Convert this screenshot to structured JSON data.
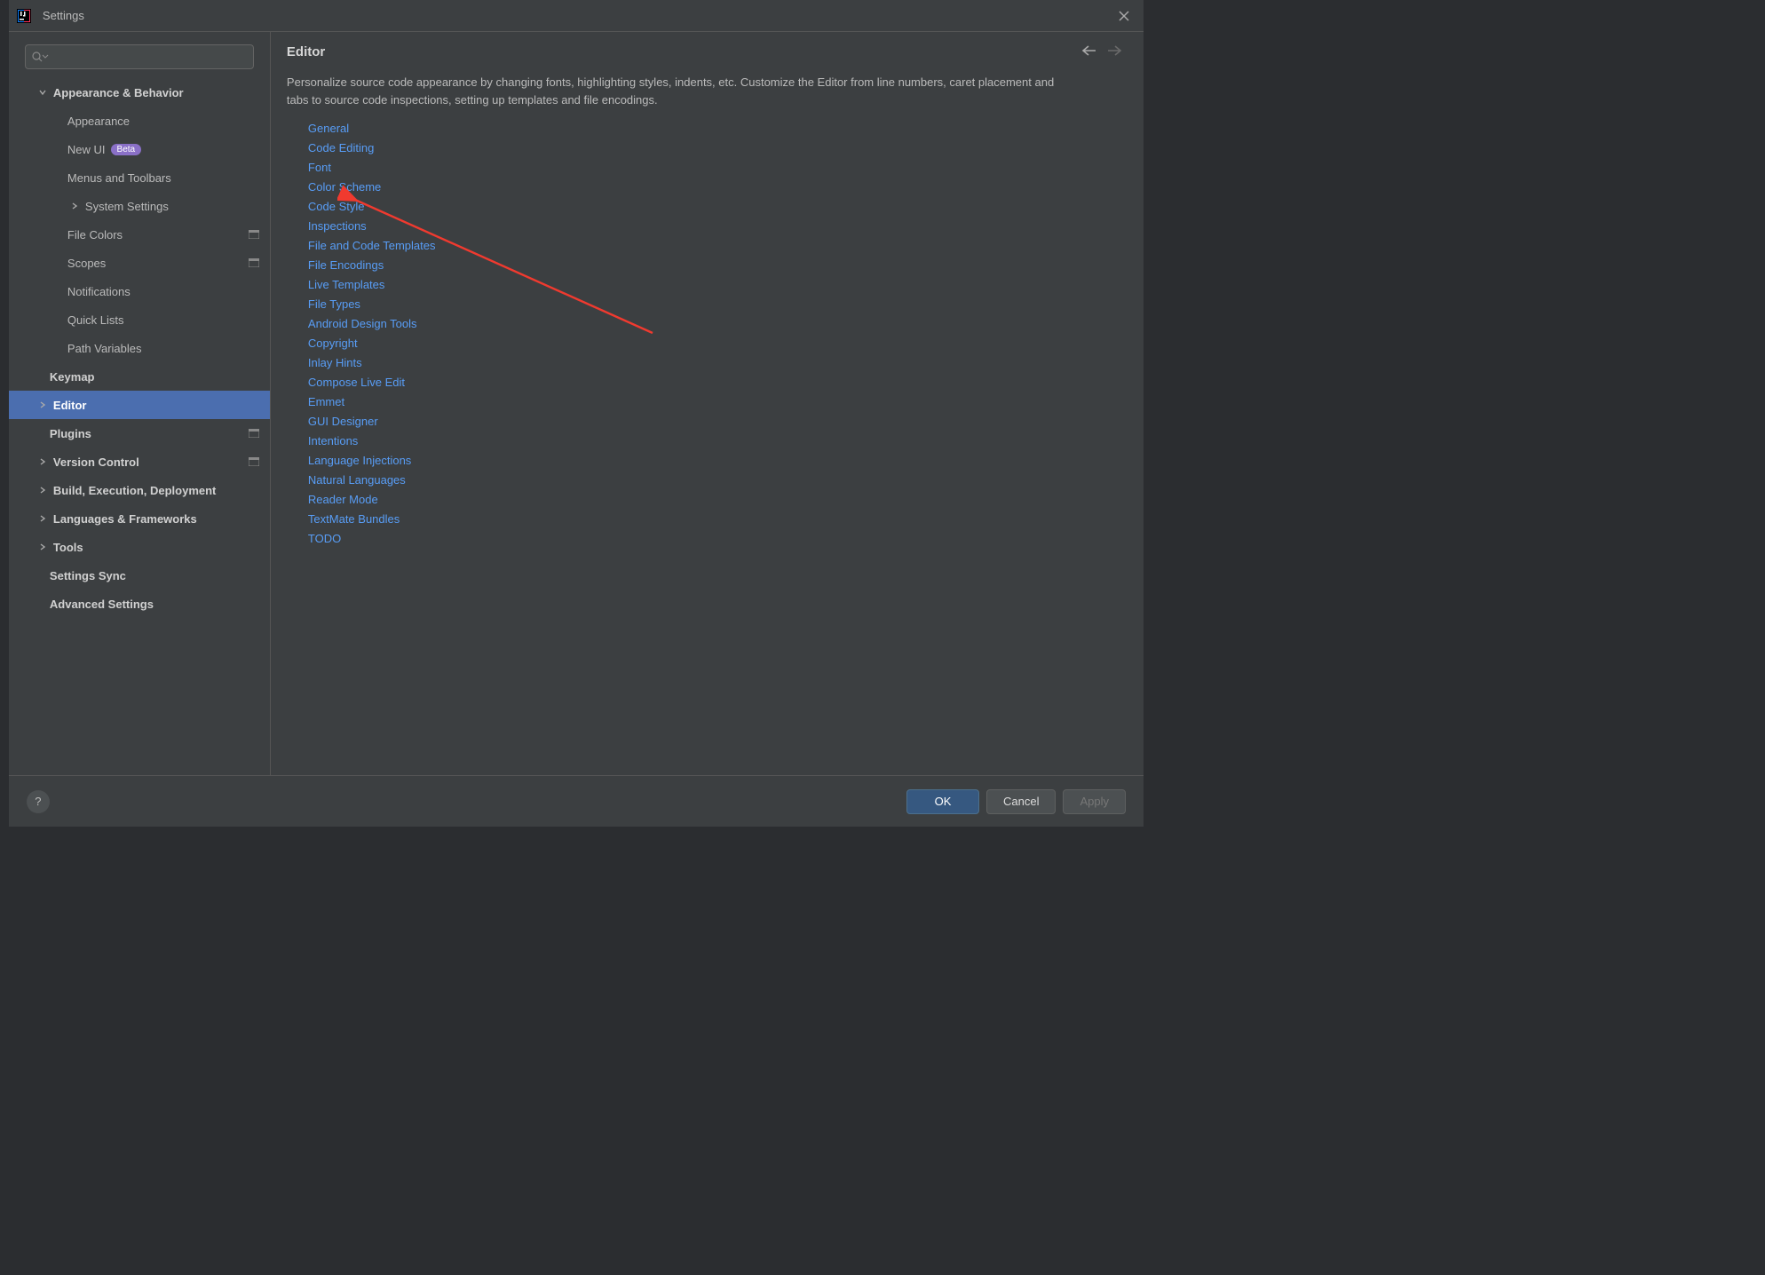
{
  "window": {
    "title": "Settings"
  },
  "sidebar": {
    "items": [
      {
        "label": "Appearance & Behavior",
        "depth": 1,
        "bold": true,
        "chev": "down"
      },
      {
        "label": "Appearance",
        "depth": 2
      },
      {
        "label": "New UI",
        "depth": 2,
        "badge": "Beta"
      },
      {
        "label": "Menus and Toolbars",
        "depth": 2
      },
      {
        "label": "System Settings",
        "depth": 2,
        "chev": "right"
      },
      {
        "label": "File Colors",
        "depth": 2,
        "projIcon": true
      },
      {
        "label": "Scopes",
        "depth": 2,
        "projIcon": true
      },
      {
        "label": "Notifications",
        "depth": 2
      },
      {
        "label": "Quick Lists",
        "depth": 2
      },
      {
        "label": "Path Variables",
        "depth": 2
      },
      {
        "label": "Keymap",
        "depth": 1,
        "bold": true
      },
      {
        "label": "Editor",
        "depth": 1,
        "bold": true,
        "chev": "right",
        "selected": true
      },
      {
        "label": "Plugins",
        "depth": 1,
        "bold": true,
        "projIcon": true
      },
      {
        "label": "Version Control",
        "depth": 1,
        "bold": true,
        "chev": "right",
        "projIcon": true
      },
      {
        "label": "Build, Execution, Deployment",
        "depth": 1,
        "bold": true,
        "chev": "right"
      },
      {
        "label": "Languages & Frameworks",
        "depth": 1,
        "bold": true,
        "chev": "right"
      },
      {
        "label": "Tools",
        "depth": 1,
        "bold": true,
        "chev": "right"
      },
      {
        "label": "Settings Sync",
        "depth": 1,
        "bold": true
      },
      {
        "label": "Advanced Settings",
        "depth": 1,
        "bold": true
      }
    ]
  },
  "main": {
    "title": "Editor",
    "description": "Personalize source code appearance by changing fonts, highlighting styles, indents, etc. Customize the Editor from line numbers, caret placement and tabs to source code inspections, setting up templates and file encodings.",
    "links": [
      "General",
      "Code Editing",
      "Font",
      "Color Scheme",
      "Code Style",
      "Inspections",
      "File and Code Templates",
      "File Encodings",
      "Live Templates",
      "File Types",
      "Android Design Tools",
      "Copyright",
      "Inlay Hints",
      "Compose Live Edit",
      "Emmet",
      "GUI Designer",
      "Intentions",
      "Language Injections",
      "Natural Languages",
      "Reader Mode",
      "TextMate Bundles",
      "TODO"
    ]
  },
  "footer": {
    "ok": "OK",
    "cancel": "Cancel",
    "apply": "Apply"
  }
}
